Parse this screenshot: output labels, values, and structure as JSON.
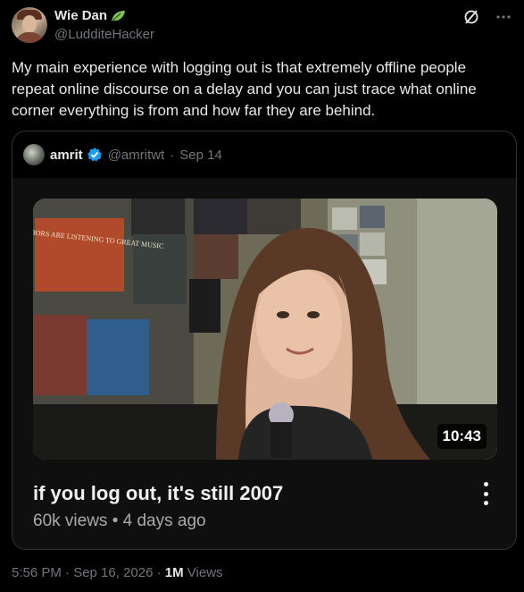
{
  "author": {
    "display_name": "Wie Dan",
    "handle": "@LudditeHacker"
  },
  "tweet": {
    "text": "My main experience with logging out is that extremely offline people repeat online discourse on a delay and you can just trace what online corner everything is from and how far they are behind."
  },
  "quote": {
    "name": "amrit",
    "handle": "@amritwt",
    "date": "Sep 14",
    "video": {
      "title": "if you log out, it's still 2007",
      "meta": "60k views • 4 days ago",
      "duration": "10:43",
      "poster_text": "MY NEIGHBORS ARE LISTENING TO GREAT MUSIC"
    }
  },
  "footer": {
    "time_date": "5:56 PM · Sep 16, 2026 · ",
    "views_count": "1M",
    "views_label": " Views"
  },
  "colors": {
    "background": "#000000",
    "text_primary": "#e7e9ea",
    "text_secondary": "#71767b",
    "verified": "#1d9bf0",
    "leaf": "#7ec35a"
  },
  "icons": [
    "leaf-icon",
    "grok-icon",
    "more-icon",
    "verified-icon",
    "video-more-icon"
  ]
}
